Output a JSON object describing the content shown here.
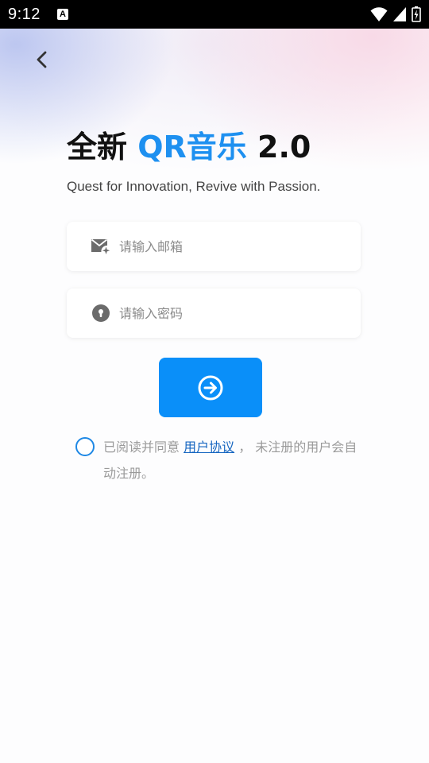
{
  "status_bar": {
    "time": "9:12",
    "notification_glyph": "A",
    "icons": [
      "wifi-icon",
      "signal-icon",
      "battery-charging-icon"
    ]
  },
  "header": {
    "back_icon": "chevron-left-icon"
  },
  "title": {
    "prefix": "全新 ",
    "accent": "QR音乐",
    "suffix": " 2.0",
    "accent_color": "#1e90f0"
  },
  "subtitle": "Quest for Innovation, Revive with Passion.",
  "form": {
    "email": {
      "placeholder": "请输入邮箱",
      "value": "",
      "icon": "mail-icon"
    },
    "password": {
      "placeholder": "请输入密码",
      "value": "",
      "icon": "lock-icon"
    },
    "submit": {
      "icon": "arrow-right-circle-icon",
      "color": "#0a8ff9"
    }
  },
  "agreement": {
    "checked": false,
    "text_before": "已阅读并同意 ",
    "link": "用户协议",
    "text_after": " ， 未注册的用户会自动注册。"
  }
}
